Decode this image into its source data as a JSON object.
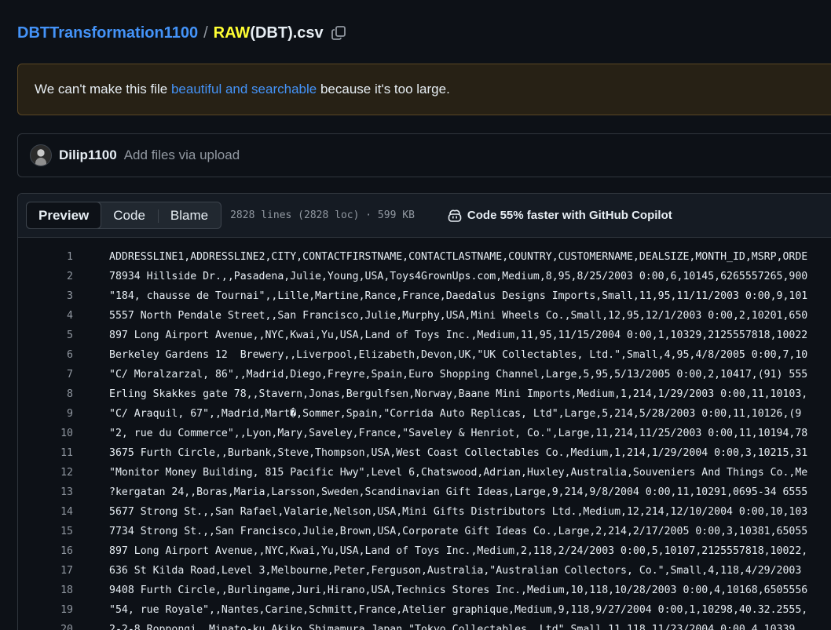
{
  "breadcrumb": {
    "repo": "DBTTransformation1100",
    "separator": "/",
    "file_highlight": "RAW",
    "file_rest": "(DBT).csv",
    "copy_icon": "copy-icon"
  },
  "banner": {
    "text_before": "We can't make this file ",
    "link": "beautiful and searchable",
    "text_after": " because it's too large.",
    "border_color": "#5a4724",
    "background_color": "#272115"
  },
  "commit": {
    "author": "Dilip1100",
    "message": "Add files via upload"
  },
  "file_header": {
    "tabs": [
      "Preview",
      "Code",
      "Blame"
    ],
    "active_tab": "Preview",
    "meta": "2828 lines (2828 loc) · 599 KB",
    "copilot_icon": "copilot-icon",
    "copilot_text": "Code 55% faster with GitHub Copilot"
  },
  "code": {
    "lines": [
      {
        "n": "1",
        "text": "ADDRESSLINE1,ADDRESSLINE2,CITY,CONTACTFIRSTNAME,CONTACTLASTNAME,COUNTRY,CUSTOMERNAME,DEALSIZE,MONTH_ID,MSRP,ORDE"
      },
      {
        "n": "2",
        "text": "78934 Hillside Dr.,,Pasadena,Julie,Young,USA,Toys4GrownUps.com,Medium,8,95,8/25/2003 0:00,6,10145,6265557265,900"
      },
      {
        "n": "3",
        "text": "\"184, chausse de Tournai\",,Lille,Martine,Rance,France,Daedalus Designs Imports,Small,11,95,11/11/2003 0:00,9,101"
      },
      {
        "n": "4",
        "text": "5557 North Pendale Street,,San Francisco,Julie,Murphy,USA,Mini Wheels Co.,Small,12,95,12/1/2003 0:00,2,10201,650"
      },
      {
        "n": "5",
        "text": "897 Long Airport Avenue,,NYC,Kwai,Yu,USA,Land of Toys Inc.,Medium,11,95,11/15/2004 0:00,1,10329,2125557818,10022"
      },
      {
        "n": "6",
        "text": "Berkeley Gardens 12  Brewery,,Liverpool,Elizabeth,Devon,UK,\"UK Collectables, Ltd.\",Small,4,95,4/8/2005 0:00,7,10"
      },
      {
        "n": "7",
        "text": "\"C/ Moralzarzal, 86\",,Madrid,Diego,Freyre,Spain,Euro Shopping Channel,Large,5,95,5/13/2005 0:00,2,10417,(91) 555"
      },
      {
        "n": "8",
        "text": "Erling Skakkes gate 78,,Stavern,Jonas,Bergulfsen,Norway,Baane Mini Imports,Medium,1,214,1/29/2003 0:00,11,10103,"
      },
      {
        "n": "9",
        "text": "\"C/ Araquil, 67\",,Madrid,Mart�,Sommer,Spain,\"Corrida Auto Replicas, Ltd\",Large,5,214,5/28/2003 0:00,11,10126,(9"
      },
      {
        "n": "10",
        "text": "\"2, rue du Commerce\",,Lyon,Mary,Saveley,France,\"Saveley & Henriot, Co.\",Large,11,214,11/25/2003 0:00,11,10194,78"
      },
      {
        "n": "11",
        "text": "3675 Furth Circle,,Burbank,Steve,Thompson,USA,West Coast Collectables Co.,Medium,1,214,1/29/2004 0:00,3,10215,31"
      },
      {
        "n": "12",
        "text": "\"Monitor Money Building, 815 Pacific Hwy\",Level 6,Chatswood,Adrian,Huxley,Australia,Souveniers And Things Co.,Me"
      },
      {
        "n": "13",
        "text": "?kergatan 24,,Boras,Maria,Larsson,Sweden,Scandinavian Gift Ideas,Large,9,214,9/8/2004 0:00,11,10291,0695-34 6555"
      },
      {
        "n": "14",
        "text": "5677 Strong St.,,San Rafael,Valarie,Nelson,USA,Mini Gifts Distributors Ltd.,Medium,12,214,12/10/2004 0:00,10,103"
      },
      {
        "n": "15",
        "text": "7734 Strong St.,,San Francisco,Julie,Brown,USA,Corporate Gift Ideas Co.,Large,2,214,2/17/2005 0:00,3,10381,65055"
      },
      {
        "n": "16",
        "text": "897 Long Airport Avenue,,NYC,Kwai,Yu,USA,Land of Toys Inc.,Medium,2,118,2/24/2003 0:00,5,10107,2125557818,10022,"
      },
      {
        "n": "17",
        "text": "636 St Kilda Road,Level 3,Melbourne,Peter,Ferguson,Australia,\"Australian Collectors, Co.\",Small,4,118,4/29/2003"
      },
      {
        "n": "18",
        "text": "9408 Furth Circle,,Burlingame,Juri,Hirano,USA,Technics Stores Inc.,Medium,10,118,10/28/2003 0:00,4,10168,6505556"
      },
      {
        "n": "19",
        "text": "\"54, rue Royale\",,Nantes,Carine,Schmitt,France,Atelier graphique,Medium,9,118,9/27/2004 0:00,1,10298,40.32.2555,"
      },
      {
        "n": "20",
        "text": "2-2-8 Roppongi,,Minato-ku,Akiko,Shimamura,Japan,\"Tokyo Collectables, Ltd\",Small,11,118,11/23/2004 0:00,4,10339,"
      }
    ]
  }
}
